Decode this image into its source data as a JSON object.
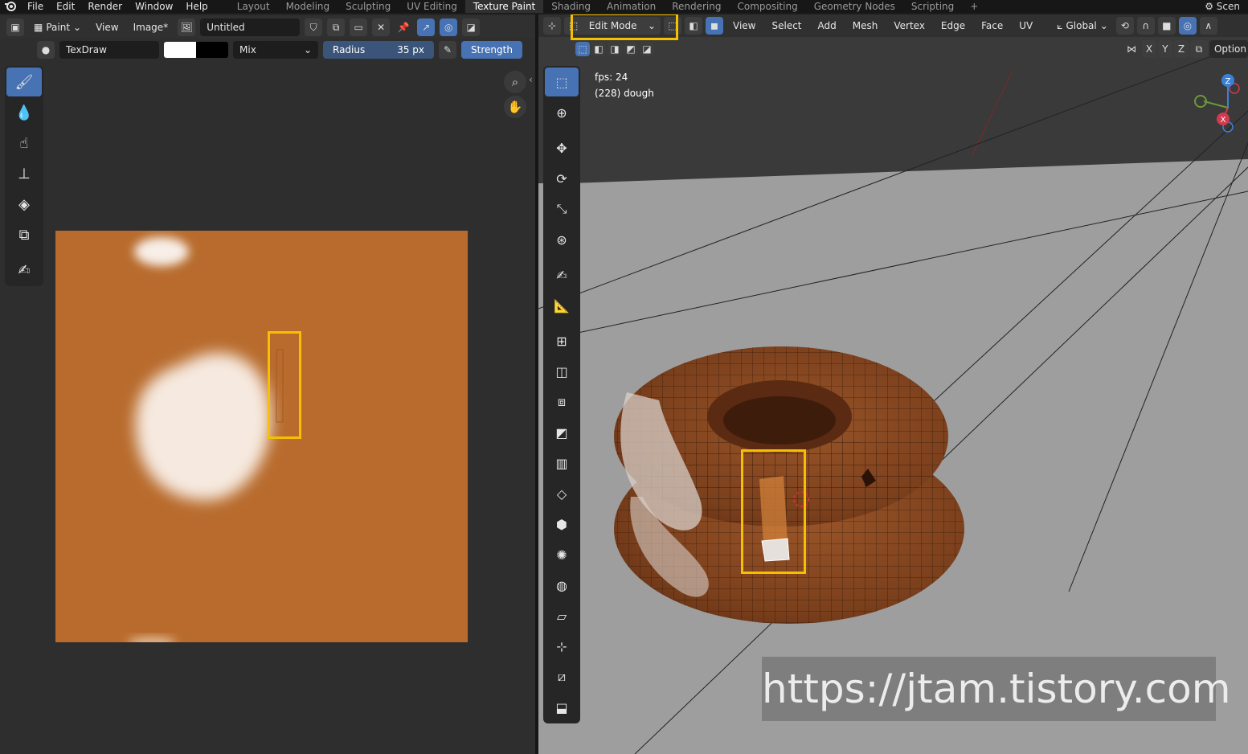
{
  "topbar": {
    "menus": [
      "File",
      "Edit",
      "Render",
      "Window",
      "Help"
    ],
    "workspace_tabs": [
      "Layout",
      "Modeling",
      "Sculpting",
      "UV Editing",
      "Texture Paint",
      "Shading",
      "Animation",
      "Rendering",
      "Compositing",
      "Geometry Nodes",
      "Scripting"
    ],
    "active_tab": "Texture Paint",
    "scene_label": "Scen"
  },
  "image_editor": {
    "mode_label": "Paint",
    "view_label": "View",
    "image_menu_label": "Image*",
    "image_name": "Untitled",
    "brush_name": "TexDraw",
    "blend_mode": "Mix",
    "radius_label": "Radius",
    "radius_value": "35 px",
    "strength_label": "Strength",
    "image_color": "#b86b2c"
  },
  "viewport": {
    "mode_label": "Edit Mode",
    "menus": [
      "View",
      "Select",
      "Add",
      "Mesh",
      "Vertex",
      "Edge",
      "Face",
      "UV"
    ],
    "orientation": "Global",
    "axis_x": "X",
    "axis_y": "Y",
    "axis_z": "Z",
    "options_label": "Option",
    "fps_text": "fps: 24",
    "object_text": "(228) dough",
    "gizmo_x": "X",
    "gizmo_z": "Z"
  },
  "colors": {
    "accent": "#4772b3",
    "highlight": "#f5c000",
    "dough": "#8a4a22"
  },
  "watermark": "https://jtam.tistory.com"
}
